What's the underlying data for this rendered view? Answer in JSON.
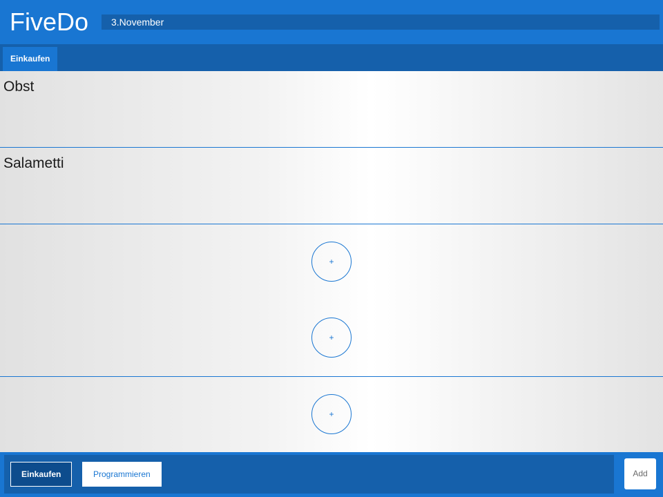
{
  "header": {
    "title": "FiveDo",
    "date": "3.November"
  },
  "tabs": [
    {
      "label": "Einkaufen",
      "active": true
    }
  ],
  "slots": [
    {
      "text": "Obst"
    },
    {
      "text": "Salametti"
    },
    {
      "text": "",
      "add_label": "+"
    },
    {
      "text": "",
      "add_label": "+"
    },
    {
      "text": "",
      "add_label": "+"
    }
  ],
  "footer": {
    "buttons": [
      {
        "label": "Einkaufen",
        "active": true
      },
      {
        "label": "Programmieren",
        "active": false
      }
    ],
    "add_label": "Add"
  },
  "colors": {
    "primary": "#1976d2",
    "primary_dark": "#1560ab",
    "selected_button": "#0d4c8d"
  }
}
